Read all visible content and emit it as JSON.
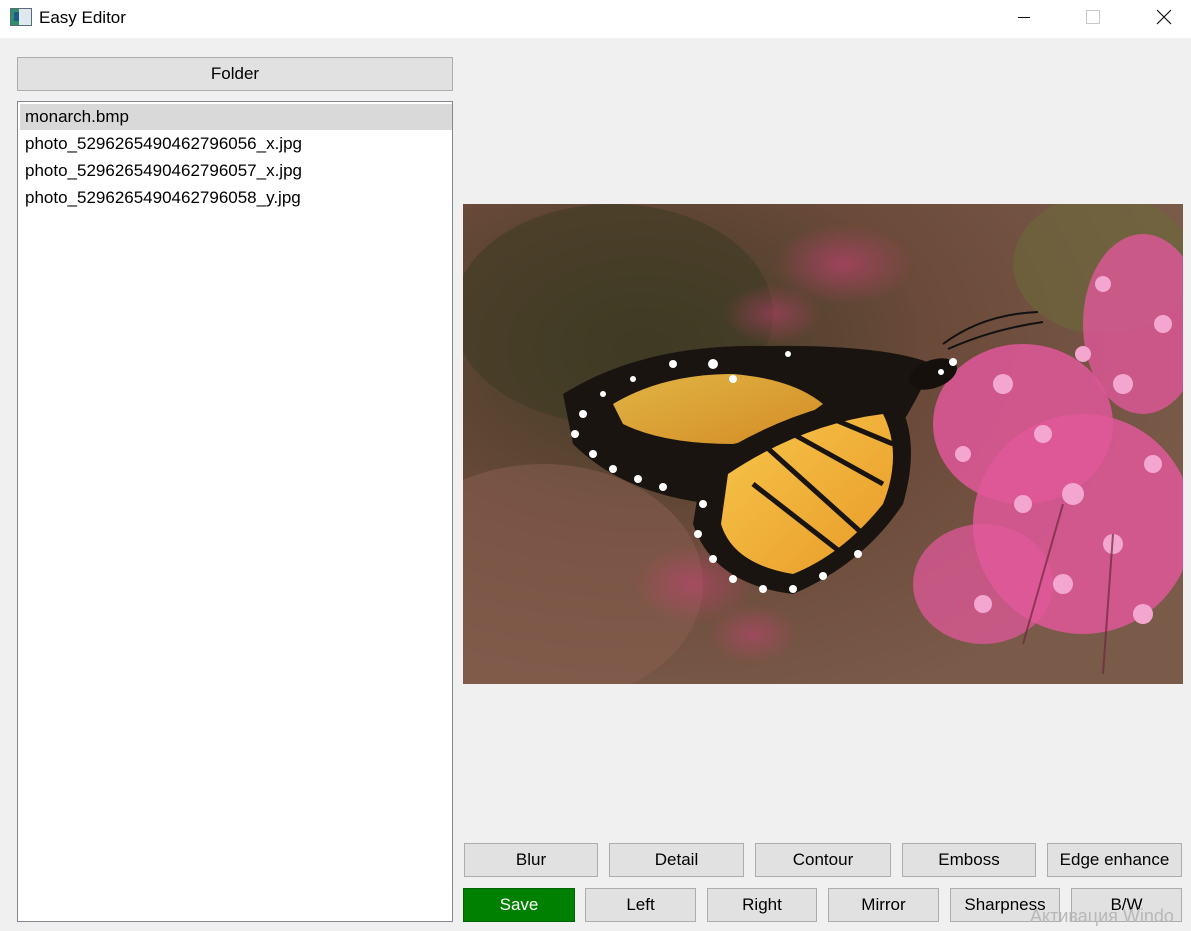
{
  "window": {
    "title": "Easy Editor"
  },
  "sidebar": {
    "folder_button": "Folder",
    "files": [
      {
        "name": "monarch.bmp",
        "selected": true
      },
      {
        "name": "photo_5296265490462796056_x.jpg",
        "selected": false
      },
      {
        "name": "photo_5296265490462796057_x.jpg",
        "selected": false
      },
      {
        "name": "photo_5296265490462796058_y.jpg",
        "selected": false
      }
    ]
  },
  "preview": {
    "image_subject": "monarch butterfly on pink flowers"
  },
  "toolbar": {
    "row1": {
      "blur": "Blur",
      "detail": "Detail",
      "contour": "Contour",
      "emboss": "Emboss",
      "edge_enhance": "Edge enhance"
    },
    "row2": {
      "save": "Save",
      "left": "Left",
      "right": "Right",
      "mirror": "Mirror",
      "sharpness": "Sharpness",
      "bw": "B/W"
    }
  },
  "system": {
    "watermark": "Активация Windo"
  },
  "colors": {
    "save_button": "#008000",
    "selected_item": "#d9d9d9",
    "window_bg": "#f0f0f0"
  }
}
